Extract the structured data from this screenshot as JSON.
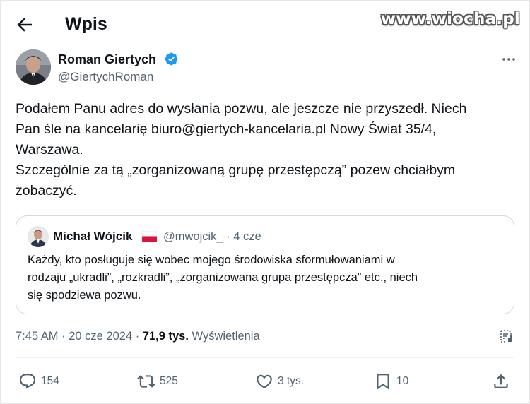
{
  "watermark": "www.wiocha.pl",
  "header": {
    "back_icon": "arrow-left-icon",
    "title": "Wpis"
  },
  "author": {
    "name": "Roman Giertych",
    "handle": "@GiertychRoman",
    "verified_icon": "verified-badge-icon",
    "verified_color": "#1d9bf0"
  },
  "tweet": {
    "lines": [
      "Podałem Panu adres do wysłania pozwu, ale jeszcze nie przyszedł. Niech",
      "Pan śle na kancelarię biuro@giertych-kancelaria.pl Nowy Świat 35/4,",
      "Warszawa.",
      "Szczególnie za tą „zorganizowaną grupę przestępczą” pozew chciałbym",
      "zobaczyć."
    ]
  },
  "quote": {
    "name": "Michał Wójcik",
    "flag_icon": "poland-flag-icon",
    "handle": "@mwojcik_",
    "separator": "·",
    "time": "4 cze",
    "lines": [
      "Każdy, kto posługuje się wobec mojego środowiska sformułowaniami w",
      "rodzaju „ukradli”, „rozkradli”, „zorganizowana grupa przestępcza” etc., niech",
      "się spodziewa pozwu."
    ]
  },
  "meta": {
    "time": "7:45 AM",
    "sep1": " · ",
    "date": "20 cze 2024",
    "sep2": " · ",
    "views_count": "71,9 tys.",
    "views_label": " Wyświetlenia"
  },
  "actions": {
    "replies": "154",
    "reposts": "525",
    "likes": "3 tys.",
    "bookmarks": "10"
  },
  "colors": {
    "text": "#0f1419",
    "secondary": "#536471",
    "border": "#cfd9de",
    "accent": "#1d9bf0"
  }
}
